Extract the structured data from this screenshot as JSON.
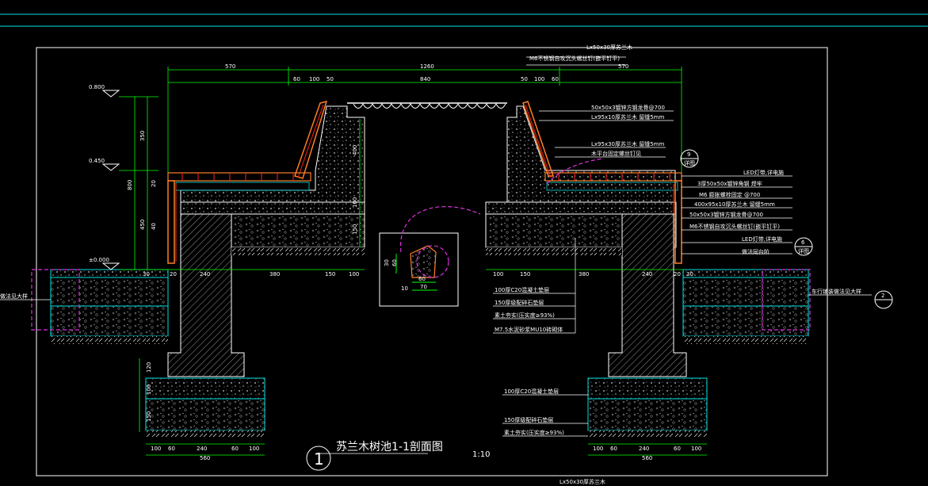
{
  "drawing": {
    "title": "苏兰木树池1-1剖面图",
    "scale": "1:10",
    "section_number": "1",
    "bottom_cut_label": "Lx50x30厚苏兰木"
  },
  "colors": {
    "background": "#000000",
    "frame": "#00e0e0",
    "dimension": "#00ff00",
    "concrete_fill": "#cfcfcf",
    "structure": "#ffffff",
    "wood": "#ff7f27",
    "fixing": "#ff2020",
    "detail_marker": "#e030e0"
  },
  "levels": [
    {
      "label": "0.800"
    },
    {
      "label": "0.450"
    },
    {
      "label": "±0.000"
    }
  ],
  "top_dimensions": {
    "row1": [
      "570",
      "1260",
      "570"
    ],
    "row2": [
      "60",
      "100",
      "50",
      "840",
      "50",
      "100",
      "60"
    ]
  },
  "left_vertical_dimensions": [
    "350",
    "400",
    "800",
    "450",
    "400",
    "100",
    "150",
    "20",
    "40"
  ],
  "ground_dimensions": {
    "left": [
      "30",
      "20",
      "240",
      "380",
      "150",
      "100"
    ],
    "right": [
      "100",
      "150",
      "380",
      "240",
      "20",
      "30"
    ]
  },
  "footing_dimensions": {
    "vertical": [
      "150",
      "120",
      "150",
      "100",
      "150"
    ],
    "left_bottom": [
      "100",
      "60",
      "240",
      "60",
      "100"
    ],
    "left_total": "560",
    "right_bottom": [
      "100",
      "60",
      "240",
      "60",
      "100"
    ],
    "right_total": "560"
  },
  "detail_inset": {
    "dims": [
      "30",
      "60",
      "60",
      "70",
      "10"
    ]
  },
  "top_annotations": [
    "Lx50x30厚苏兰木",
    "M6不锈钢自攻沉头螺丝钉(嵌平钉平)",
    "50x50x3镀锌方钢龙骨@700",
    "Lx95x10厚苏兰木 留缝5mm",
    "Lx95x30厚苏兰木 留缝5mm",
    "木平台固定螺丝钉见",
    "LED灯带,详电施",
    "3厚50x50x镀锌角钢 焊牢",
    "M6 膨胀螺栓固定 @700",
    "400x95x10厚苏兰木 留缝5mm",
    "50x50x3镀锌方钢龙骨@700",
    "M6不锈钢自攻沉头螺丝钉(嵌平钉平)",
    "LED灯带,详电施",
    "做法同台阶"
  ],
  "layer_annotations_mid": [
    "100厚C20混凝土垫层",
    "150厚级配碎石垫层",
    "素土夯实(压实度≥93%)",
    "M7.5水泥砂浆MU10砖砌体"
  ],
  "layer_annotations_bottom": [
    "100厚C20混凝土垫层",
    "150厚级配碎石垫层",
    "素土夯实(压实度≥93%)"
  ],
  "side_notes": {
    "left": "做法见大样",
    "right": "车行铺装做法见大样"
  },
  "detail_callouts": [
    {
      "top": "9",
      "bottom": "详图"
    },
    {
      "top": "6",
      "bottom": "详图"
    },
    {
      "top": "2",
      "bottom": ""
    }
  ]
}
